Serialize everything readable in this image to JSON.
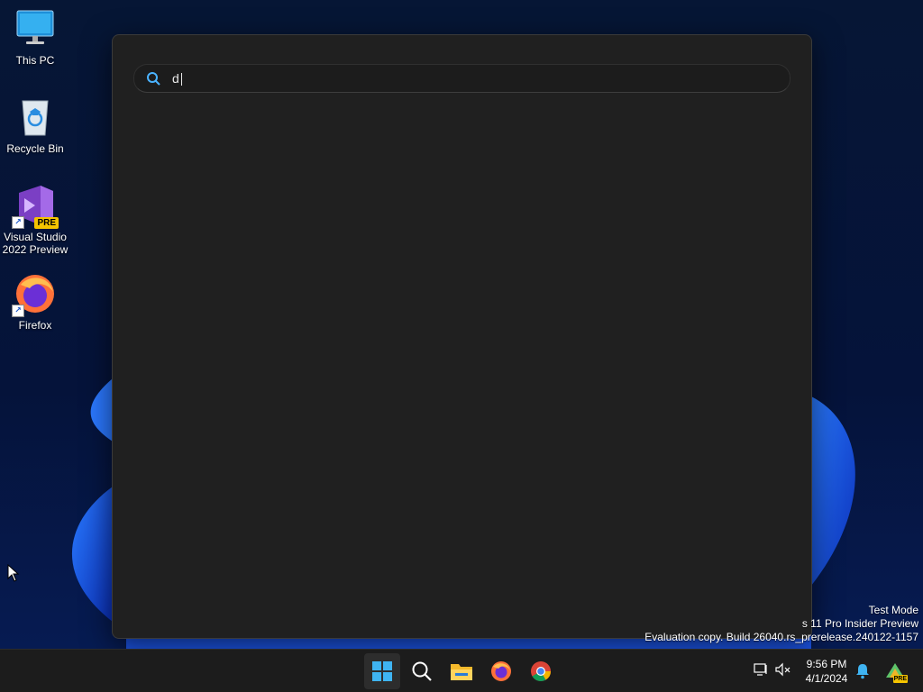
{
  "desktop": {
    "icons": [
      {
        "label": "This PC"
      },
      {
        "label": "Recycle Bin"
      },
      {
        "label": "Visual Studio\n2022 Preview",
        "badge": "PRE"
      },
      {
        "label": "Firefox"
      }
    ]
  },
  "search": {
    "query": "d"
  },
  "watermark": {
    "line1": "Test Mode",
    "line2": "s 11 Pro Insider Preview",
    "line3": "Evaluation copy. Build 26040.rs_prerelease.240122-1157"
  },
  "taskbar": {
    "clock_time": "9:56 PM",
    "clock_date": "4/1/2024",
    "pinned": [
      "start-icon",
      "search-icon",
      "file-explorer-icon",
      "firefox-icon",
      "chrome-icon"
    ],
    "tray": [
      "network-icon",
      "volume-muted-icon",
      "notification-bell-icon",
      "dev-home-pre-icon"
    ],
    "tray_badge": "PRE"
  },
  "colors": {
    "accent": "#0078d4",
    "flyout_bg": "#202020",
    "taskbar_bg": "#1c1c1c"
  }
}
